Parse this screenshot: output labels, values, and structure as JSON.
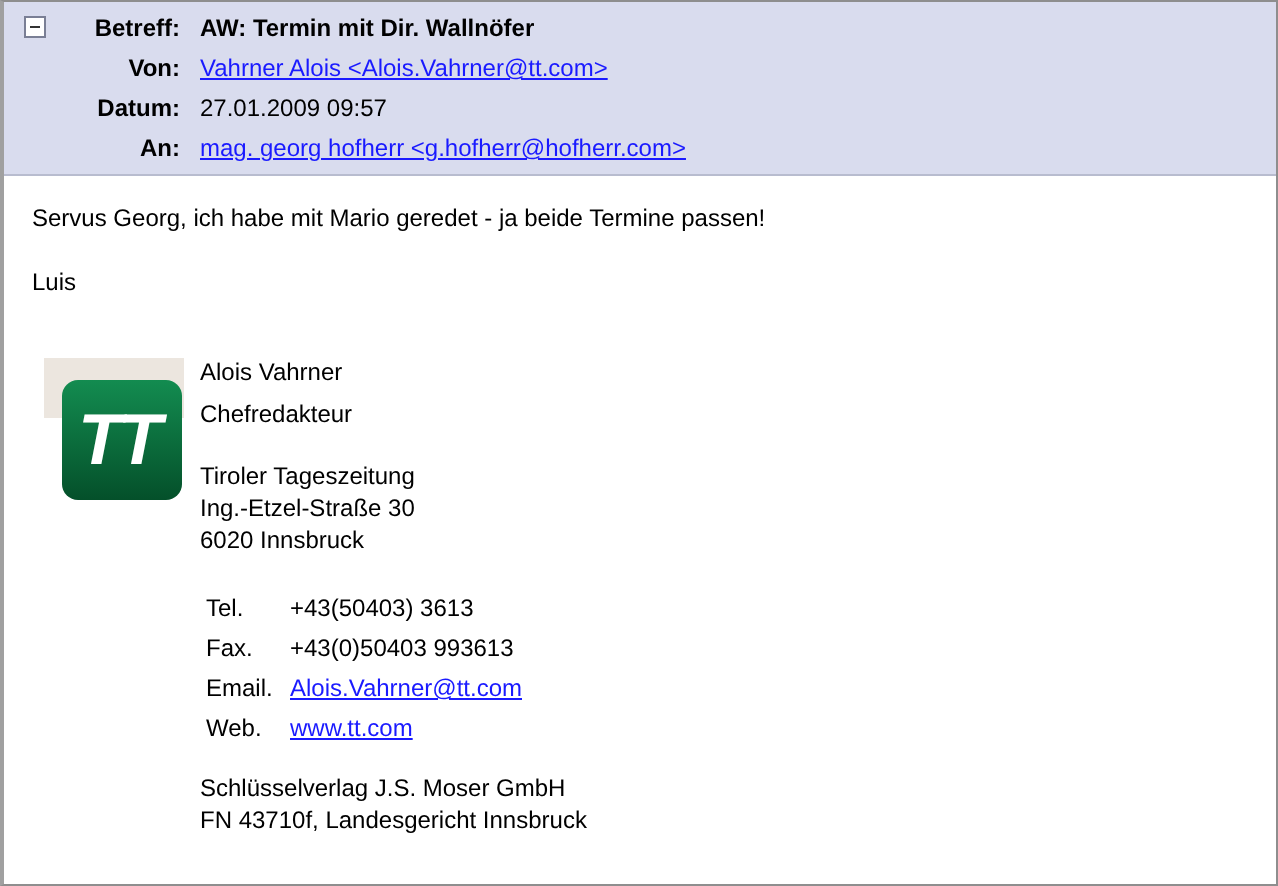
{
  "header": {
    "expanded": true,
    "fields": [
      {
        "label": "Betreff:",
        "value": "AW: Termin mit Dir. Wallnöfer",
        "kind": "subject"
      },
      {
        "label": "Von:",
        "value": "Vahrner Alois <Alois.Vahrner@tt.com>",
        "kind": "link"
      },
      {
        "label": "Datum:",
        "value": "27.01.2009 09:57",
        "kind": "text"
      },
      {
        "label": "An:",
        "value": "mag. georg hofherr <g.hofherr@hofherr.com>",
        "kind": "link"
      }
    ]
  },
  "body": [
    "Servus Georg, ich habe mit Mario geredet - ja beide Termine passen!",
    "Luis"
  ],
  "signature": {
    "logo_text": "TT",
    "name_lines": [
      "Alois Vahrner",
      "Chefredakteur"
    ],
    "address_lines": [
      "Tiroler Tageszeitung",
      "Ing.-Etzel-Straße 30",
      "6020 Innsbruck"
    ],
    "contacts": [
      {
        "label": "Tel.",
        "value": "+43(50403) 3613",
        "kind": "text"
      },
      {
        "label": "Fax.",
        "value": "+43(0)50403 993613",
        "kind": "text"
      },
      {
        "label": "Email.",
        "value": "Alois.Vahrner@tt.com",
        "kind": "link"
      },
      {
        "label": "Web.",
        "value": "www.tt.com",
        "kind": "link"
      }
    ],
    "footer_lines": [
      "Schlüsselverlag J.S. Moser GmbH",
      "FN 43710f, Landesgericht Innsbruck"
    ]
  }
}
